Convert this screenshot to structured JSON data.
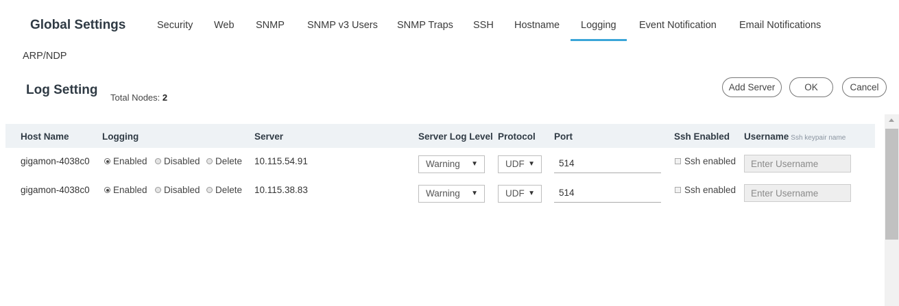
{
  "nav": {
    "title": "Global Settings",
    "tabs": [
      "Security",
      "Web",
      "SNMP",
      "SNMP v3 Users",
      "SNMP Traps",
      "SSH",
      "Hostname",
      "Logging",
      "Event Notification",
      "Email Notifications",
      "ARP/NDP"
    ],
    "active_tab": "Logging"
  },
  "page": {
    "title": "Log Setting",
    "total_nodes_label": "Total Nodes:",
    "total_nodes_value": "2"
  },
  "actions": {
    "add_server": "Add Server",
    "ok": "OK",
    "cancel": "Cancel"
  },
  "table": {
    "columns": {
      "host_name": "Host Name",
      "logging": "Logging",
      "server": "Server",
      "server_log_level": "Server Log Level",
      "protocol": "Protocol",
      "port": "Port",
      "ssh_enabled": "Ssh Enabled",
      "username": "Username",
      "username_hint": "Ssh keypair name"
    },
    "logging_options": [
      "Enabled",
      "Disabled",
      "Delete"
    ],
    "ssh_checkbox_label": "Ssh enabled",
    "username_placeholder": "Enter Username",
    "rows": [
      {
        "host": "gigamon-4038c0",
        "logging": "Enabled",
        "server": "10.115.54.91",
        "log_level": "Warning",
        "protocol": "UDF",
        "port": "514",
        "ssh_enabled": false,
        "username": ""
      },
      {
        "host": "gigamon-4038c0",
        "logging": "Enabled",
        "server": "10.115.38.83",
        "log_level": "Warning",
        "protocol": "UDF",
        "port": "514",
        "ssh_enabled": false,
        "username": ""
      }
    ]
  },
  "colors": {
    "accent": "#3aa5d8",
    "header_bg": "#eef2f5",
    "title_text": "#2f3a44"
  }
}
